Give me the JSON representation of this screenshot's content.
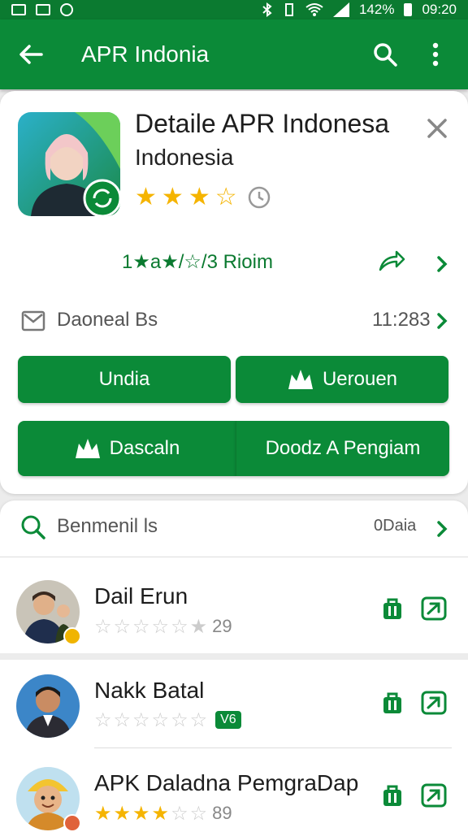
{
  "status_bar": {
    "battery": "142%",
    "time": "09:20"
  },
  "app_bar": {
    "title": "APR Indonia",
    "back_icon": "back-arrow-icon",
    "search_icon": "search-icon",
    "menu_icon": "more-vert-icon"
  },
  "detail": {
    "title": "Detaile APR Indonesa",
    "subtitle": "Indonesia",
    "stars_filled": 3,
    "stars_total": 4,
    "rating_text": "1★a★/☆/3 Rioim",
    "downloads_label": "Daoneal Bs",
    "downloads_count": "11:283",
    "buttons": {
      "b1": "Undia",
      "b2": "Uerouen",
      "b3": "Dascaln",
      "b4": "Doodz A Pengiam"
    }
  },
  "list": {
    "header_label": "Benmenil ls",
    "header_count": "0Daia",
    "items": [
      {
        "name": "Dail Erun",
        "stars_filled": 0,
        "rating": "29",
        "tag": ""
      },
      {
        "name": "Nakk Batal",
        "stars_filled": 0,
        "rating": "",
        "tag": "V6"
      },
      {
        "name": "APK Daladna PemgraDap",
        "stars_filled": 4,
        "rating": "89",
        "tag": ""
      }
    ]
  },
  "colors": {
    "primary": "#0b8a38",
    "dark": "#0b7a30",
    "star": "#f5b400"
  }
}
